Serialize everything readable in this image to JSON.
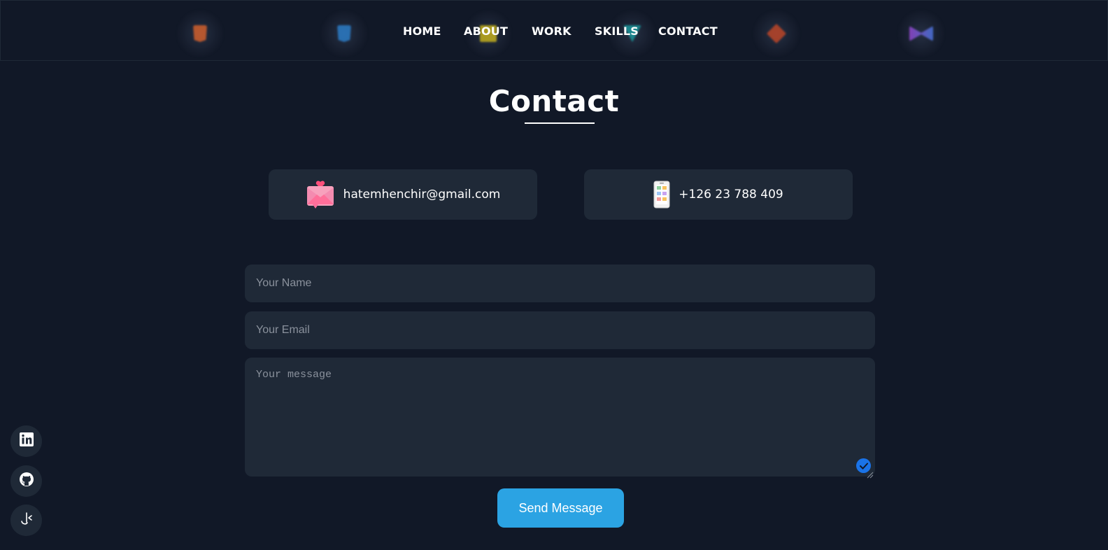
{
  "nav": {
    "items": [
      {
        "label": "HOME"
      },
      {
        "label": "ABOUT"
      },
      {
        "label": "WORK"
      },
      {
        "label": "SKILLS"
      },
      {
        "label": "CONTACT"
      }
    ]
  },
  "background_icons": [
    "html5-icon",
    "css3-icon",
    "javascript-icon",
    "vue-icon",
    "git-icon",
    "figma-icon"
  ],
  "page": {
    "title": "Contact"
  },
  "contact": {
    "email": "hatemhenchir@gmail.com",
    "phone": "+126 23 788 409"
  },
  "form": {
    "name_placeholder": "Your Name",
    "email_placeholder": "Your Email",
    "message_placeholder": "Your message",
    "submit_label": "Send Message"
  },
  "social": [
    "linkedin-icon",
    "github-icon",
    "kaggle-icon"
  ],
  "colors": {
    "background": "#111827",
    "card": "#1f2937",
    "accent": "#2ba3e3",
    "text": "#ffffff"
  }
}
